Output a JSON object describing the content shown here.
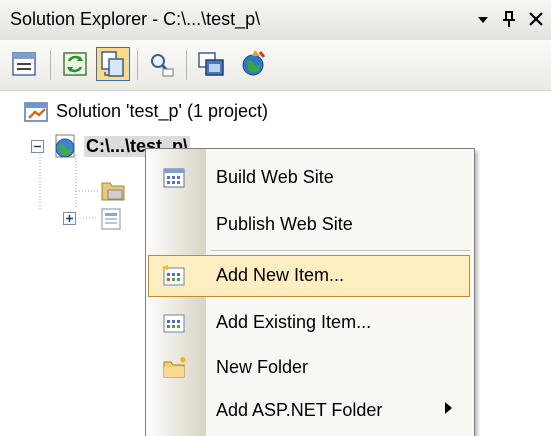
{
  "titlebar": {
    "title": "Solution Explorer - C:\\...\\test_p\\",
    "dropdown_glyph": "▾",
    "pin_glyph": "ᵖ",
    "close_glyph": "✕"
  },
  "toolbar": {
    "buttons": [
      {
        "icon": "properties-icon"
      },
      {
        "icon": "refresh-icon"
      },
      {
        "icon": "nest-related-files-icon",
        "active": true
      },
      {
        "icon": "view-code-icon"
      },
      {
        "icon": "view-designer-icon"
      },
      {
        "icon": "asp-net-configuration-icon"
      }
    ]
  },
  "tree": {
    "solution_label": "Solution 'test_p' (1 project)",
    "project_label": "C:\\...\\test_p\\"
  },
  "context_menu": {
    "items": [
      {
        "label": "Build Web Site",
        "icon": "build-icon"
      },
      {
        "label": "Publish Web Site",
        "icon": ""
      },
      {
        "label": "Add New Item...",
        "icon": "add-new-item-icon",
        "highlighted": true
      },
      {
        "label": "Add Existing Item...",
        "icon": "add-existing-item-icon"
      },
      {
        "label": "New Folder",
        "icon": "new-folder-icon"
      },
      {
        "label": "Add ASP.NET Folder",
        "icon": "",
        "submenu": true
      }
    ]
  },
  "colors": {
    "highlight_bg": "#ffeec2",
    "highlight_border": "#c88c1c",
    "toolbar_active": "#ffd98a"
  }
}
